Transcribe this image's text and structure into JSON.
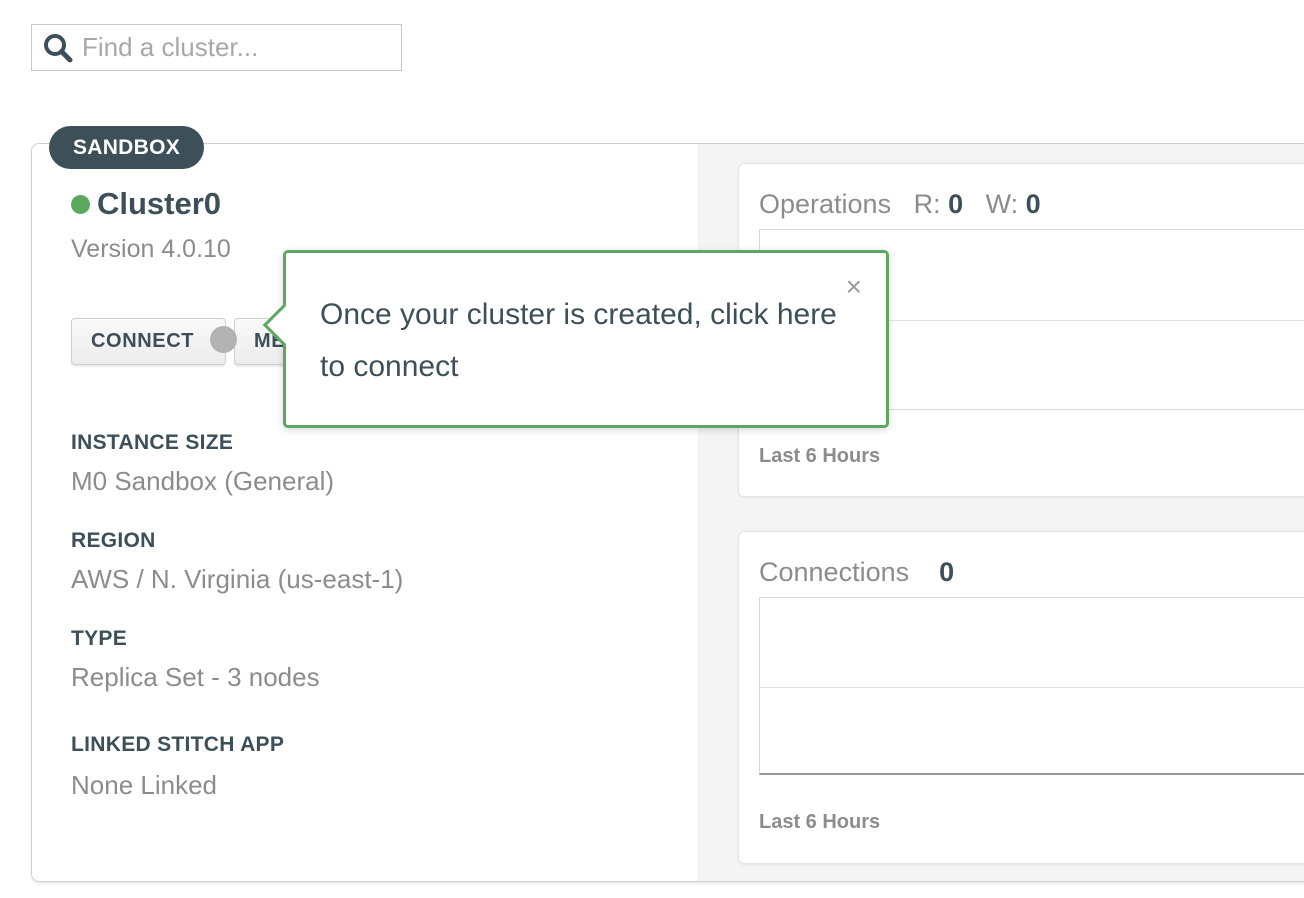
{
  "search": {
    "placeholder": "Find a cluster..."
  },
  "cluster": {
    "badge": "SANDBOX",
    "name": "Cluster0",
    "version": "Version 4.0.10",
    "status_color": "#5ba85f",
    "buttons": {
      "connect": "CONNECT",
      "metrics": "METRICS"
    },
    "info": [
      {
        "label": "INSTANCE SIZE",
        "value": "M0 Sandbox (General)"
      },
      {
        "label": "REGION",
        "value": "AWS / N. Virginia (us-east-1)"
      },
      {
        "label": "TYPE",
        "value": "Replica Set - 3 nodes"
      },
      {
        "label": "LINKED STITCH APP",
        "value": "None Linked"
      }
    ]
  },
  "tooltip": {
    "text": "Once your cluster is created, click here to connect",
    "close": "×",
    "border_color": "#5ba85f"
  },
  "panels": {
    "operations": {
      "title": "Operations",
      "r_label": "R:",
      "r_value": "0",
      "w_label": "W:",
      "w_value": "0",
      "footer": "Last 6 Hours"
    },
    "connections": {
      "title": "Connections",
      "value": "0",
      "footer": "Last 6 Hours"
    }
  },
  "colors": {
    "badge_bg": "#3d4f58",
    "accent_green": "#5ba85f"
  }
}
